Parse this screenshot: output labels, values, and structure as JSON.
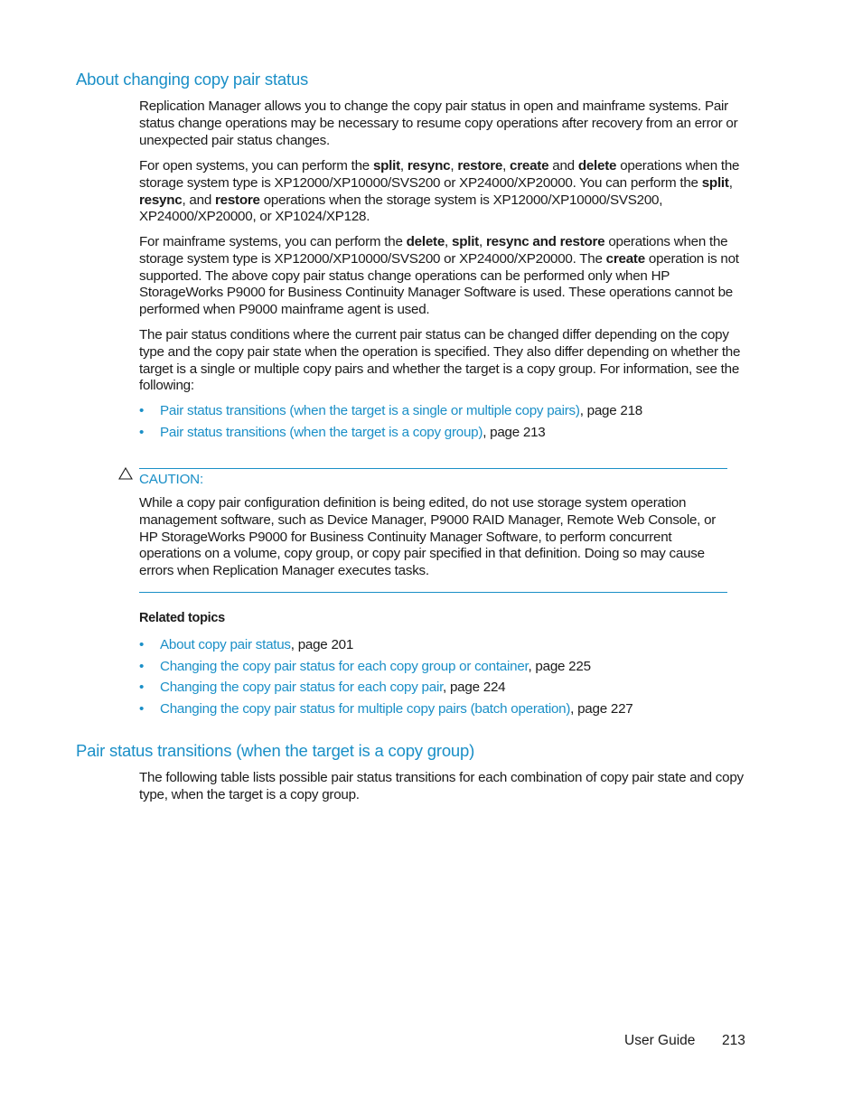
{
  "section1": {
    "heading": "About changing copy pair status",
    "p1": "Replication Manager allows you to change the copy pair status in open and mainframe systems. Pair status change operations may be necessary to resume copy operations after recovery from an error or unexpected pair status changes.",
    "p2": {
      "t1": "For open systems, you can perform the ",
      "b1": "split",
      "t2": ", ",
      "b2": "resync",
      "t3": ", ",
      "b3": "restore",
      "t4": ", ",
      "b4": "create",
      "t5": " and ",
      "b5": "delete",
      "t6": " operations when the storage system type is XP12000/XP10000/SVS200 or XP24000/XP20000. You can perform the ",
      "b6": "split",
      "t7": ", ",
      "b7": "resync",
      "t8": ", and ",
      "b8": "restore",
      "t9": " operations when the storage system is XP12000/XP10000/SVS200, XP24000/XP20000, or XP1024/XP128."
    },
    "p3": {
      "t1": "For mainframe systems, you can perform the ",
      "b1": "delete",
      "t2": ", ",
      "b2": "split",
      "t3": ", ",
      "b3": "resync and restore",
      "t4": " operations when the storage system type is XP12000/XP10000/SVS200 or XP24000/XP20000. The ",
      "b4": "create",
      "t5": " operation is not supported. The above copy pair status change operations can be performed only when HP StorageWorks P9000 for Business Continuity Manager Software is used. These operations cannot be performed when P9000 mainframe agent is used."
    },
    "p4": "The pair status conditions where the current pair status can be changed differ depending on the copy type and the copy pair state when the operation is specified. They also differ depending on whether the target is a single or multiple copy pairs and whether the target is a copy group. For information, see the following:",
    "links": [
      {
        "link": "Pair status transitions (when the target is a single or multiple copy pairs)",
        "suffix": ", page 218"
      },
      {
        "link": "Pair status transitions (when the target is a copy group)",
        "suffix": ", page 213"
      }
    ]
  },
  "caution": {
    "icon": "warning-triangle-icon",
    "label": "CAUTION:",
    "text": "While a copy pair configuration definition is being edited, do not use storage system operation management software, such as Device Manager, P9000 RAID Manager, Remote Web Console, or HP StorageWorks P9000 for Business Continuity Manager Software, to perform concurrent operations on a volume, copy group, or copy pair specified in that definition. Doing so may cause errors when Replication Manager executes tasks."
  },
  "related": {
    "title": "Related topics",
    "items": [
      {
        "link": "About copy pair status",
        "suffix": ", page 201"
      },
      {
        "link": "Changing the copy pair status for each copy group or container",
        "suffix": ", page 225"
      },
      {
        "link": "Changing the copy pair status for each copy pair",
        "suffix": ", page 224"
      },
      {
        "link": "Changing the copy pair status for multiple copy pairs (batch operation)",
        "suffix": ", page 227"
      }
    ]
  },
  "section2": {
    "heading": "Pair status transitions (when the target is a copy group)",
    "p1": "The following table lists possible pair status transitions for each combination of copy pair state and copy type, when the target is a copy group."
  },
  "footer": {
    "label": "User Guide",
    "page": "213"
  },
  "colors": {
    "accent": "#1a8fc7",
    "text": "#1a1a1a"
  }
}
